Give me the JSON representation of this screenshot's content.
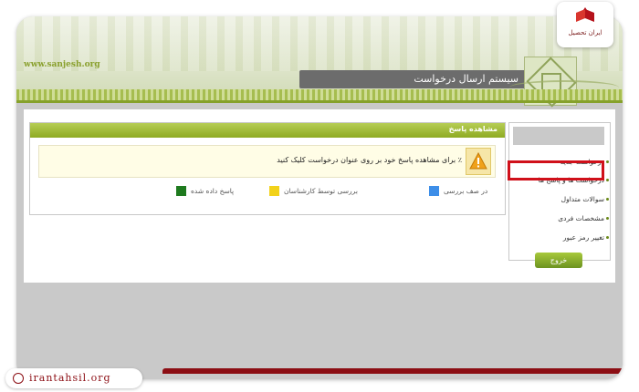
{
  "header": {
    "site_url": "www.sanjesh.org",
    "title": "سیستم ارسال درخواست"
  },
  "panel": {
    "title": "مشاهده پاسخ",
    "info_text": "٪ برای مشاهده پاسخ خود بر روی عنوان درخواست کلیک کنید",
    "legend": [
      {
        "label": "در صف بررسی",
        "color": "#3d8ee8"
      },
      {
        "label": "بررسی توسط کارشناسان",
        "color": "#f2d21a"
      },
      {
        "label": "پاسخ داده شده",
        "color": "#1e7a1e"
      }
    ]
  },
  "sidebar": {
    "items": [
      {
        "label": "درخواست جدید"
      },
      {
        "label": "درخواست ها و پاسخ ها"
      },
      {
        "label": "سوالات متداول"
      },
      {
        "label": "مشخصات فردی"
      },
      {
        "label": "تغییر رمز عبور"
      }
    ],
    "logout_label": "خروج",
    "highlighted_item": "درخواست جدید"
  },
  "badge": {
    "text": "ایران تحصیل"
  },
  "watermark": {
    "text": "irantahsil.org"
  },
  "colors": {
    "accent_green": "#8eab22",
    "title_bar": "#6c6c6c",
    "highlight_red": "#d0101a",
    "footer_red": "#8c0e14"
  }
}
